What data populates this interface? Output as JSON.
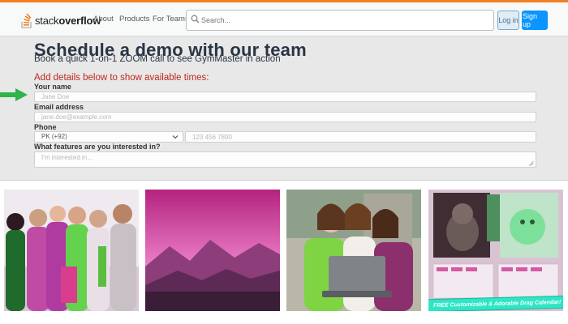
{
  "so_header": {
    "logo_text_light": "stack",
    "logo_text_bold": "overflow",
    "nav": [
      "About",
      "Products",
      "For Teams"
    ],
    "search_placeholder": "Search...",
    "login_label": "Log in",
    "signup_label": "Sign up",
    "accent_color": "#f48024"
  },
  "form": {
    "heading": "Schedule a demo with our team",
    "subheading": "Book a quick 1-on-1 ZOOM call to see GymMaster in action",
    "details_title": "Add details below to show available times:",
    "name_label": "Your name",
    "name_placeholder": "Jane Doe",
    "email_label": "Email address",
    "email_placeholder": "jane.doe@example.com",
    "phone_label": "Phone",
    "country_value": "PK (+92)",
    "phone_placeholder": "123 456 7890",
    "features_label": "What features are you interested in?",
    "features_placeholder": "I'm interested in..."
  },
  "cards": {
    "banner_text": "FREE Customizable & Adorable Drag Calendar!"
  }
}
